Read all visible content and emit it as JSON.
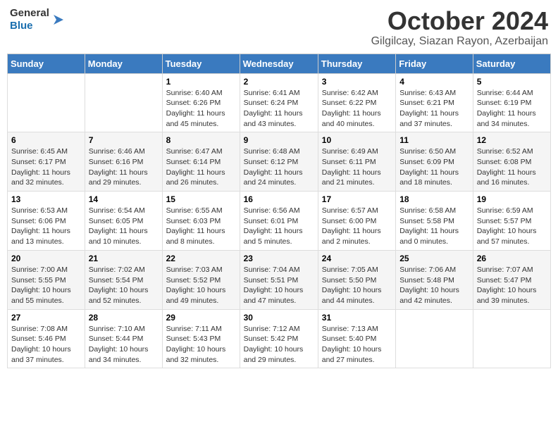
{
  "header": {
    "logo_line1": "General",
    "logo_line2": "Blue",
    "month": "October 2024",
    "location": "Gilgilcay, Siazan Rayon, Azerbaijan"
  },
  "days_of_week": [
    "Sunday",
    "Monday",
    "Tuesday",
    "Wednesday",
    "Thursday",
    "Friday",
    "Saturday"
  ],
  "weeks": [
    [
      {
        "num": "",
        "sunrise": "",
        "sunset": "",
        "daylight": ""
      },
      {
        "num": "",
        "sunrise": "",
        "sunset": "",
        "daylight": ""
      },
      {
        "num": "1",
        "sunrise": "Sunrise: 6:40 AM",
        "sunset": "Sunset: 6:26 PM",
        "daylight": "Daylight: 11 hours and 45 minutes."
      },
      {
        "num": "2",
        "sunrise": "Sunrise: 6:41 AM",
        "sunset": "Sunset: 6:24 PM",
        "daylight": "Daylight: 11 hours and 43 minutes."
      },
      {
        "num": "3",
        "sunrise": "Sunrise: 6:42 AM",
        "sunset": "Sunset: 6:22 PM",
        "daylight": "Daylight: 11 hours and 40 minutes."
      },
      {
        "num": "4",
        "sunrise": "Sunrise: 6:43 AM",
        "sunset": "Sunset: 6:21 PM",
        "daylight": "Daylight: 11 hours and 37 minutes."
      },
      {
        "num": "5",
        "sunrise": "Sunrise: 6:44 AM",
        "sunset": "Sunset: 6:19 PM",
        "daylight": "Daylight: 11 hours and 34 minutes."
      }
    ],
    [
      {
        "num": "6",
        "sunrise": "Sunrise: 6:45 AM",
        "sunset": "Sunset: 6:17 PM",
        "daylight": "Daylight: 11 hours and 32 minutes."
      },
      {
        "num": "7",
        "sunrise": "Sunrise: 6:46 AM",
        "sunset": "Sunset: 6:16 PM",
        "daylight": "Daylight: 11 hours and 29 minutes."
      },
      {
        "num": "8",
        "sunrise": "Sunrise: 6:47 AM",
        "sunset": "Sunset: 6:14 PM",
        "daylight": "Daylight: 11 hours and 26 minutes."
      },
      {
        "num": "9",
        "sunrise": "Sunrise: 6:48 AM",
        "sunset": "Sunset: 6:12 PM",
        "daylight": "Daylight: 11 hours and 24 minutes."
      },
      {
        "num": "10",
        "sunrise": "Sunrise: 6:49 AM",
        "sunset": "Sunset: 6:11 PM",
        "daylight": "Daylight: 11 hours and 21 minutes."
      },
      {
        "num": "11",
        "sunrise": "Sunrise: 6:50 AM",
        "sunset": "Sunset: 6:09 PM",
        "daylight": "Daylight: 11 hours and 18 minutes."
      },
      {
        "num": "12",
        "sunrise": "Sunrise: 6:52 AM",
        "sunset": "Sunset: 6:08 PM",
        "daylight": "Daylight: 11 hours and 16 minutes."
      }
    ],
    [
      {
        "num": "13",
        "sunrise": "Sunrise: 6:53 AM",
        "sunset": "Sunset: 6:06 PM",
        "daylight": "Daylight: 11 hours and 13 minutes."
      },
      {
        "num": "14",
        "sunrise": "Sunrise: 6:54 AM",
        "sunset": "Sunset: 6:05 PM",
        "daylight": "Daylight: 11 hours and 10 minutes."
      },
      {
        "num": "15",
        "sunrise": "Sunrise: 6:55 AM",
        "sunset": "Sunset: 6:03 PM",
        "daylight": "Daylight: 11 hours and 8 minutes."
      },
      {
        "num": "16",
        "sunrise": "Sunrise: 6:56 AM",
        "sunset": "Sunset: 6:01 PM",
        "daylight": "Daylight: 11 hours and 5 minutes."
      },
      {
        "num": "17",
        "sunrise": "Sunrise: 6:57 AM",
        "sunset": "Sunset: 6:00 PM",
        "daylight": "Daylight: 11 hours and 2 minutes."
      },
      {
        "num": "18",
        "sunrise": "Sunrise: 6:58 AM",
        "sunset": "Sunset: 5:58 PM",
        "daylight": "Daylight: 11 hours and 0 minutes."
      },
      {
        "num": "19",
        "sunrise": "Sunrise: 6:59 AM",
        "sunset": "Sunset: 5:57 PM",
        "daylight": "Daylight: 10 hours and 57 minutes."
      }
    ],
    [
      {
        "num": "20",
        "sunrise": "Sunrise: 7:00 AM",
        "sunset": "Sunset: 5:55 PM",
        "daylight": "Daylight: 10 hours and 55 minutes."
      },
      {
        "num": "21",
        "sunrise": "Sunrise: 7:02 AM",
        "sunset": "Sunset: 5:54 PM",
        "daylight": "Daylight: 10 hours and 52 minutes."
      },
      {
        "num": "22",
        "sunrise": "Sunrise: 7:03 AM",
        "sunset": "Sunset: 5:52 PM",
        "daylight": "Daylight: 10 hours and 49 minutes."
      },
      {
        "num": "23",
        "sunrise": "Sunrise: 7:04 AM",
        "sunset": "Sunset: 5:51 PM",
        "daylight": "Daylight: 10 hours and 47 minutes."
      },
      {
        "num": "24",
        "sunrise": "Sunrise: 7:05 AM",
        "sunset": "Sunset: 5:50 PM",
        "daylight": "Daylight: 10 hours and 44 minutes."
      },
      {
        "num": "25",
        "sunrise": "Sunrise: 7:06 AM",
        "sunset": "Sunset: 5:48 PM",
        "daylight": "Daylight: 10 hours and 42 minutes."
      },
      {
        "num": "26",
        "sunrise": "Sunrise: 7:07 AM",
        "sunset": "Sunset: 5:47 PM",
        "daylight": "Daylight: 10 hours and 39 minutes."
      }
    ],
    [
      {
        "num": "27",
        "sunrise": "Sunrise: 7:08 AM",
        "sunset": "Sunset: 5:46 PM",
        "daylight": "Daylight: 10 hours and 37 minutes."
      },
      {
        "num": "28",
        "sunrise": "Sunrise: 7:10 AM",
        "sunset": "Sunset: 5:44 PM",
        "daylight": "Daylight: 10 hours and 34 minutes."
      },
      {
        "num": "29",
        "sunrise": "Sunrise: 7:11 AM",
        "sunset": "Sunset: 5:43 PM",
        "daylight": "Daylight: 10 hours and 32 minutes."
      },
      {
        "num": "30",
        "sunrise": "Sunrise: 7:12 AM",
        "sunset": "Sunset: 5:42 PM",
        "daylight": "Daylight: 10 hours and 29 minutes."
      },
      {
        "num": "31",
        "sunrise": "Sunrise: 7:13 AM",
        "sunset": "Sunset: 5:40 PM",
        "daylight": "Daylight: 10 hours and 27 minutes."
      },
      {
        "num": "",
        "sunrise": "",
        "sunset": "",
        "daylight": ""
      },
      {
        "num": "",
        "sunrise": "",
        "sunset": "",
        "daylight": ""
      }
    ]
  ]
}
